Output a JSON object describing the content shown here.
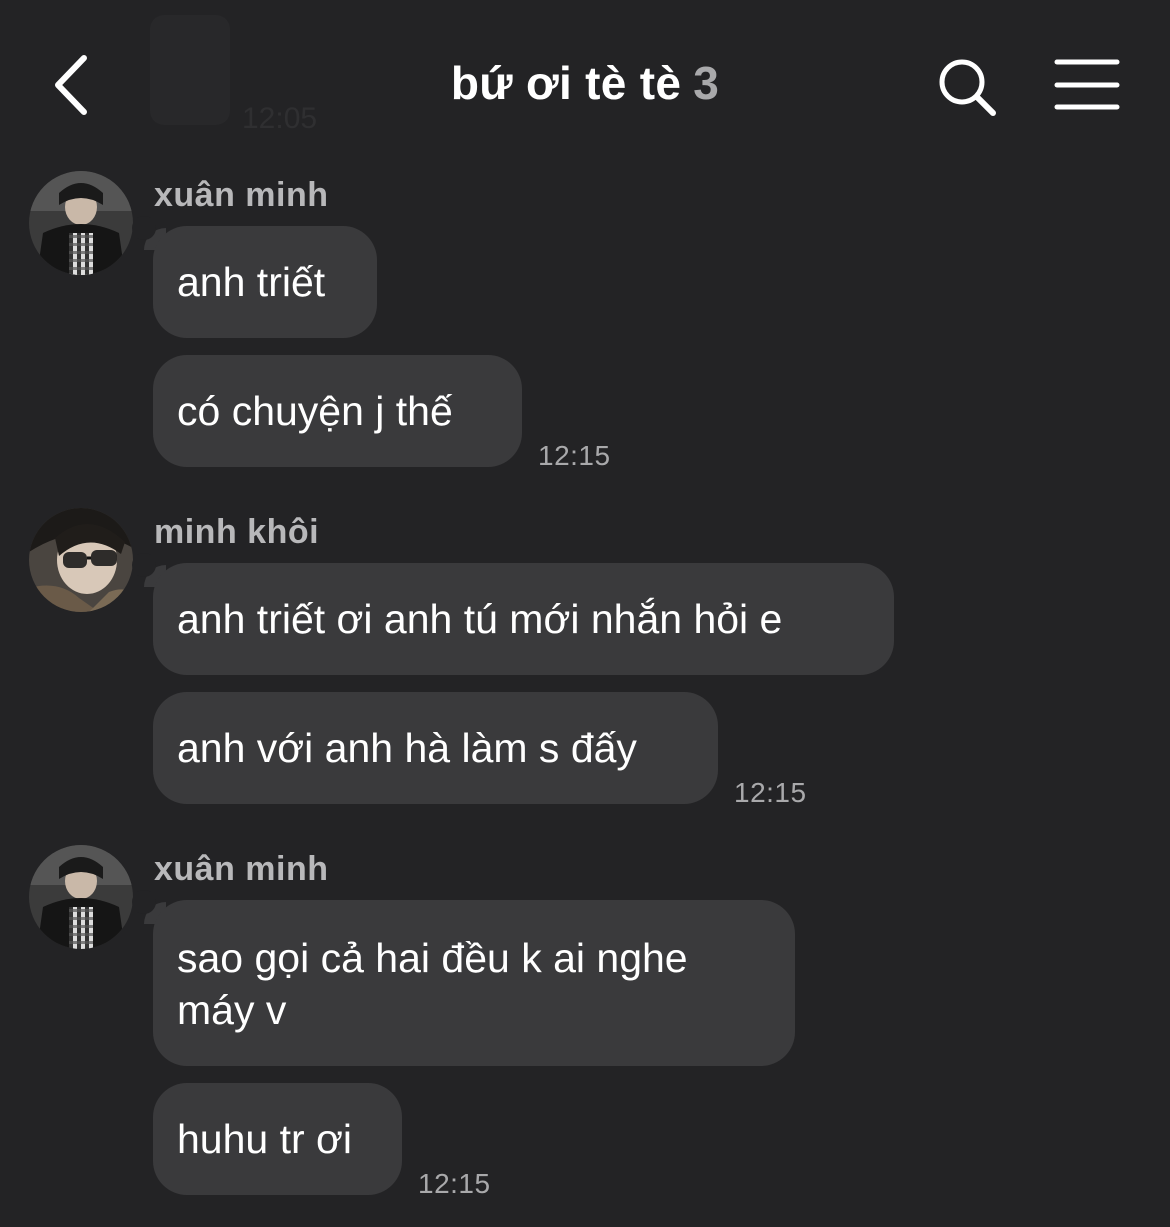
{
  "header": {
    "title": "bứ ơi tè tè",
    "member_count": "3",
    "faded_time": "12:05"
  },
  "icons": {
    "back": "chevron-left-icon",
    "search": "search-icon",
    "menu": "hamburger-menu-icon"
  },
  "colors": {
    "background": "#232325",
    "bubble": "#3a3a3c",
    "secondary_text": "#a9a9ab"
  },
  "messages": [
    {
      "sender": "xuân minh",
      "lines": [
        "anh triết",
        "có chuyện j thế"
      ],
      "time": "12:15"
    },
    {
      "sender": "minh khôi",
      "lines": [
        "anh triết ơi anh tú mới nhắn hỏi e",
        "anh với anh hà làm s đấy"
      ],
      "time": "12:15"
    },
    {
      "sender": "xuân minh",
      "lines": [
        "sao gọi cả hai đều k ai nghe máy v",
        "huhu tr ơi"
      ],
      "time": "12:15"
    }
  ]
}
